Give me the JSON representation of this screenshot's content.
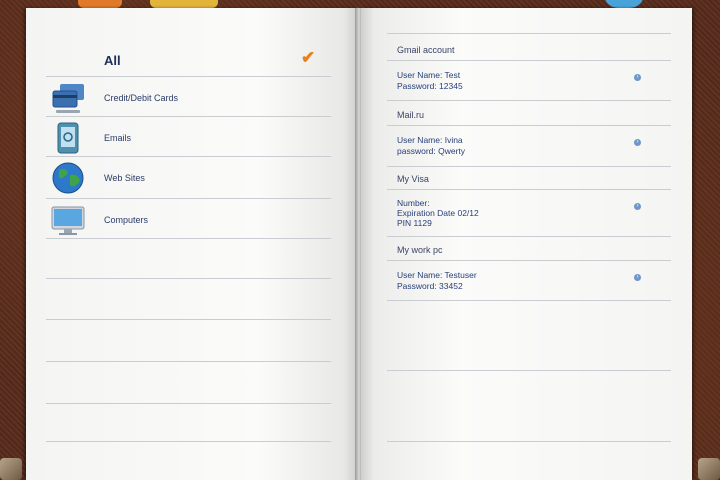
{
  "left_page": {
    "header_label": "All",
    "categories": [
      {
        "label": "Credit/Debit Cards",
        "icon": "credit-card-icon"
      },
      {
        "label": "Emails",
        "icon": "email-icon"
      },
      {
        "label": "Web Sites",
        "icon": "globe-icon"
      },
      {
        "label": "Computers",
        "icon": "computer-icon"
      }
    ]
  },
  "right_page": {
    "groups": [
      {
        "title": "Gmail account",
        "lines": [
          "User Name: Test",
          "Password: 12345"
        ]
      },
      {
        "title": "Mail.ru",
        "lines": [
          "User Name: Ivina",
          "password: Qwerty"
        ]
      },
      {
        "title": "My Visa",
        "lines": [
          "Number:",
          "Expiration Date 02/12",
          "PIN 1129"
        ]
      },
      {
        "title": "My work pc",
        "lines": [
          "User Name: Testuser",
          "Password: 33452"
        ]
      }
    ]
  }
}
